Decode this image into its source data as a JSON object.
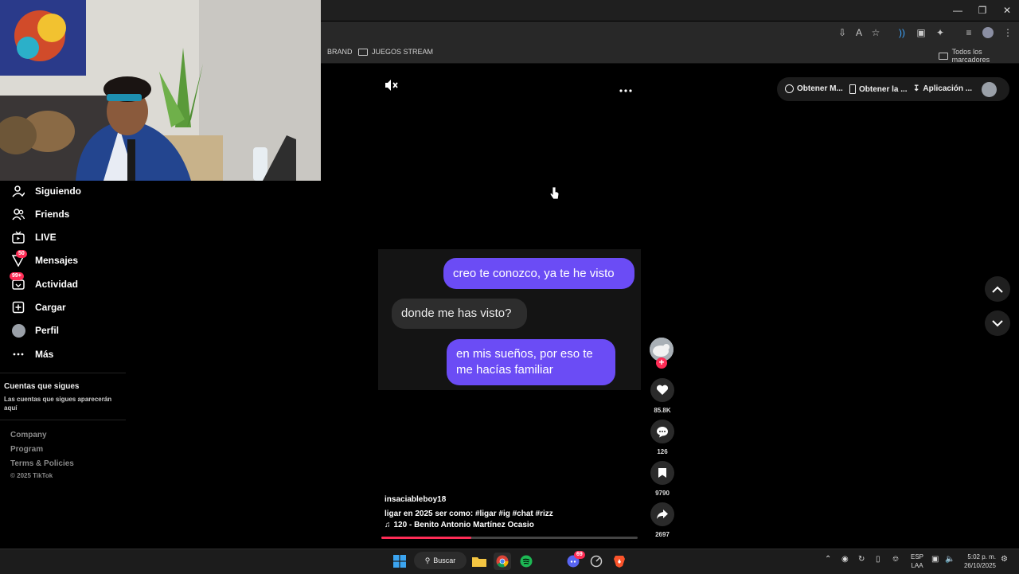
{
  "browser": {
    "bookmarks": [
      "BRAND",
      "JUEGOS STREAM"
    ],
    "all_bookmarks": "Todos los marcadores"
  },
  "sidebar": {
    "items": [
      {
        "label": "Siguiendo",
        "icon": "user-follow-icon",
        "badge": ""
      },
      {
        "label": "Friends",
        "icon": "friends-icon",
        "badge": ""
      },
      {
        "label": "LIVE",
        "icon": "live-tv-icon",
        "badge": ""
      },
      {
        "label": "Mensajes",
        "icon": "send-icon",
        "badge": "50"
      },
      {
        "label": "Actividad",
        "icon": "inbox-icon",
        "badge": "99+"
      },
      {
        "label": "Cargar",
        "icon": "plus-square-icon",
        "badge": ""
      },
      {
        "label": "Perfil",
        "icon": "avatar-icon",
        "badge": ""
      },
      {
        "label": "Más",
        "icon": "more-dots-icon",
        "badge": ""
      }
    ],
    "following_title": "Cuentas que sigues",
    "following_desc": "Las cuentas que sigues aparecerán aquí",
    "footer": [
      "Company",
      "Program",
      "Terms & Policies"
    ],
    "copyright": "© 2025 TikTok"
  },
  "top_actions": {
    "get_coins": "Obtener M...",
    "get_app": "Obtener la ...",
    "pc_app": "Aplicación ..."
  },
  "video": {
    "messages": [
      {
        "from": "me",
        "text": "creo te conozco, ya te he visto"
      },
      {
        "from": "them",
        "text": "donde me has visto?"
      },
      {
        "from": "me",
        "text": "en mis sueños, por eso te me hacías familiar"
      }
    ],
    "author": "insaciableboy18",
    "caption": "ligar en 2025 ser como: #ligar #ig #chat #rizz",
    "music": "120 - Benito Antonio Martínez Ocasio",
    "progress": 0.35
  },
  "actions": {
    "likes": "85.8K",
    "comments": "126",
    "saves": "9790",
    "shares": "2697"
  },
  "taskbar": {
    "search": "Buscar",
    "lang_top": "ESP",
    "lang_bottom": "LAA",
    "time": "5:02 p. m.",
    "date": "26/10/2025",
    "discord_badge": "69"
  },
  "colors": {
    "accent": "#fe2c55",
    "bubble_out": "#6b4cf5",
    "bubble_in": "#2d2d2d"
  }
}
